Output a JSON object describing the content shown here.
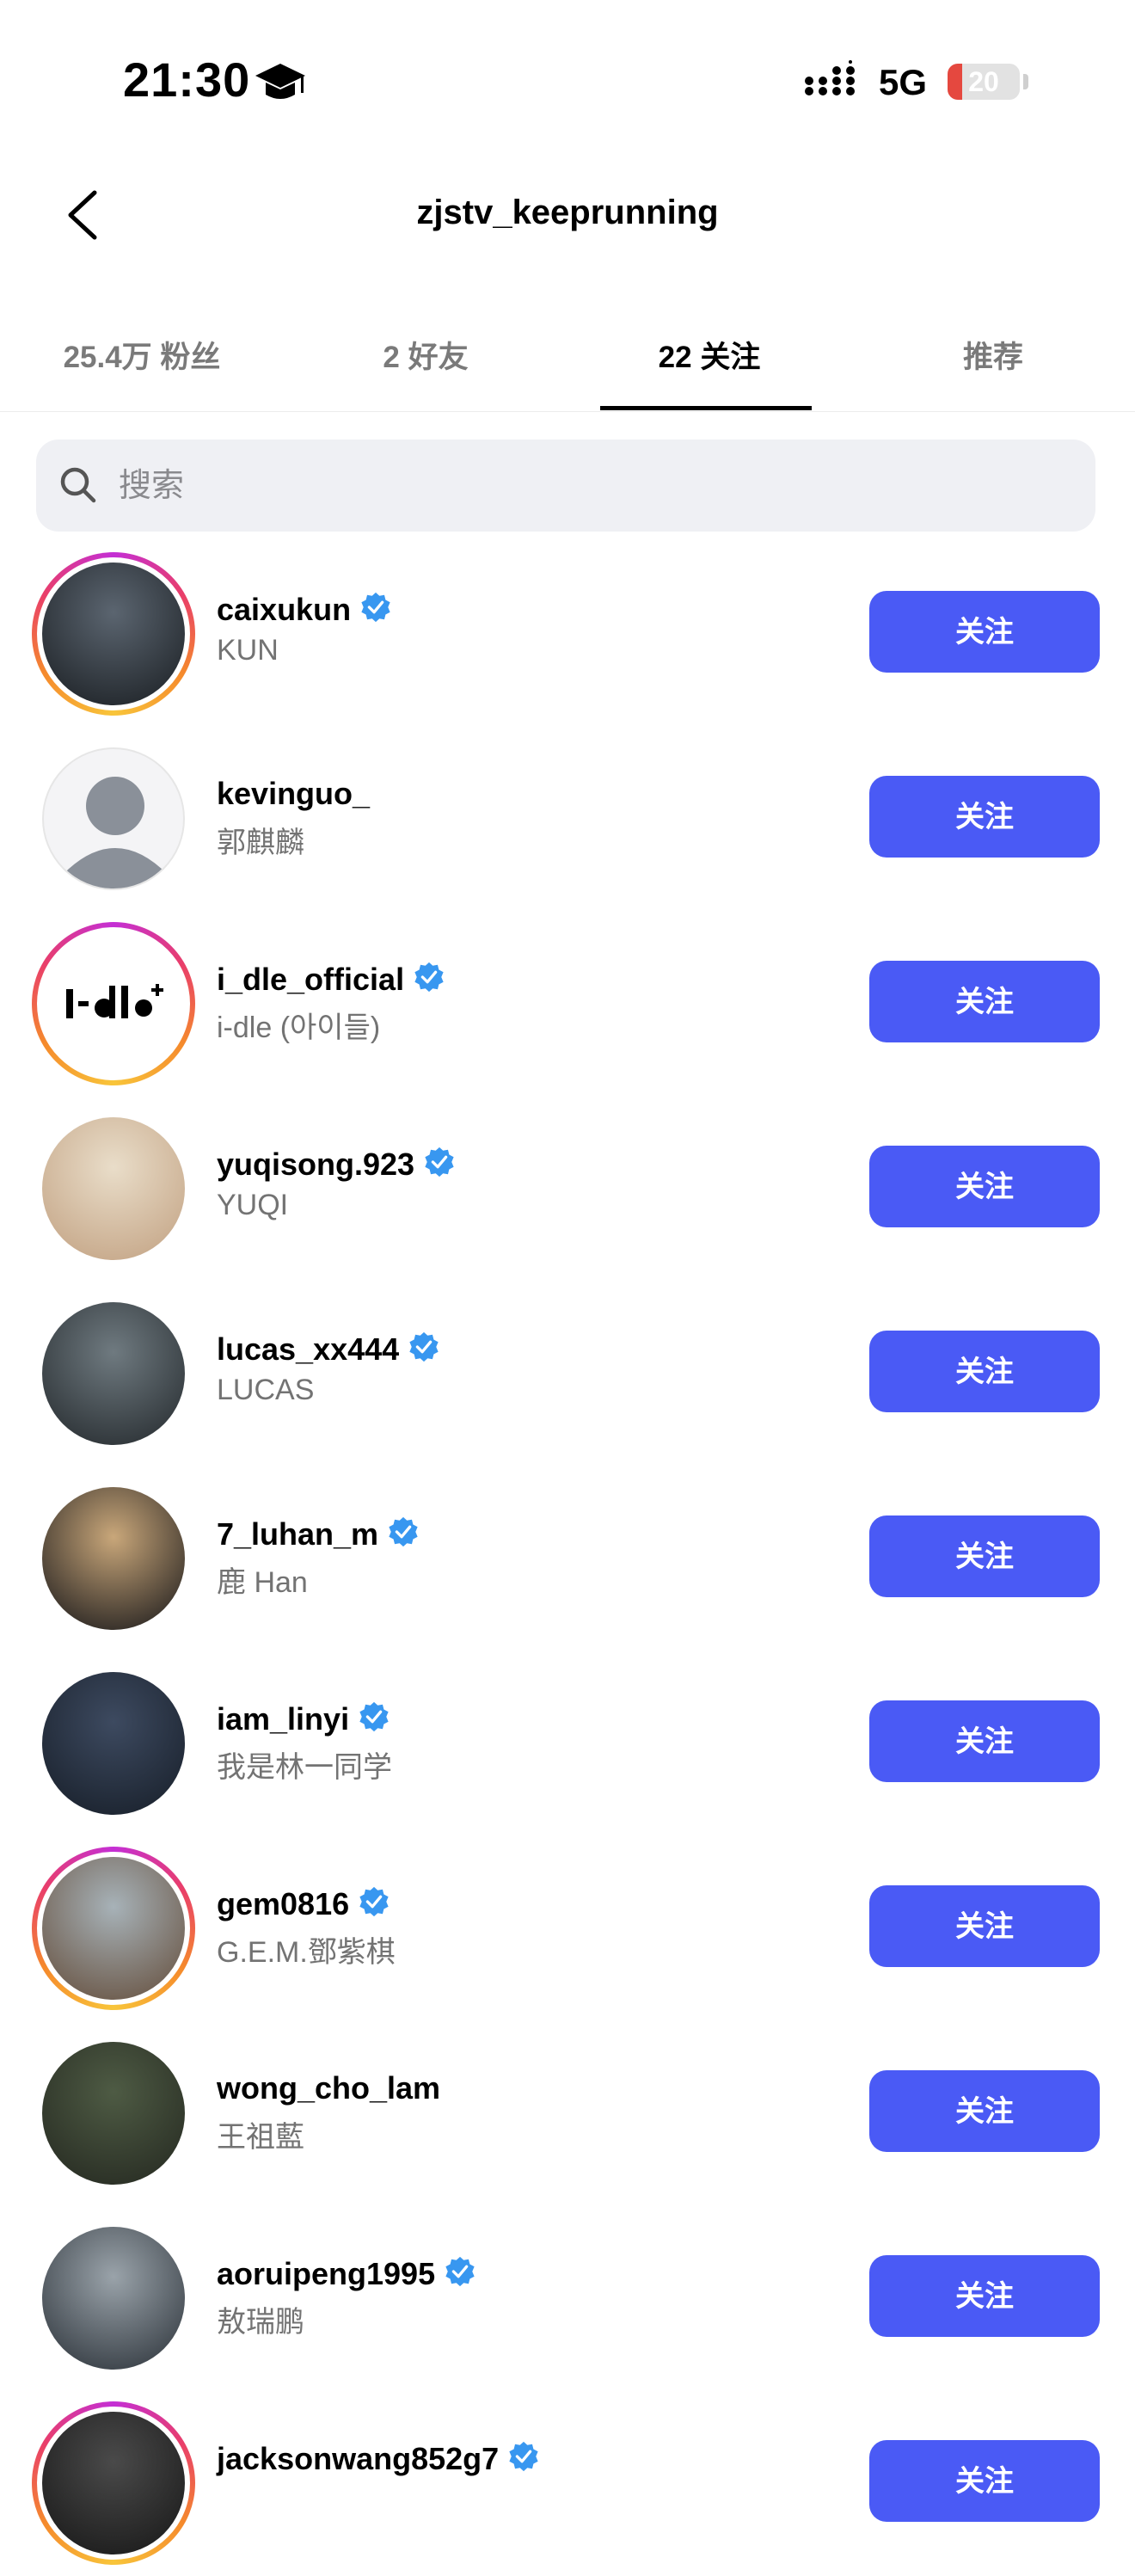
{
  "status_bar": {
    "time": "21:30",
    "network": "5G",
    "battery": "20",
    "battery_level": 0.2
  },
  "header": {
    "title": "zjstv_keeprunning"
  },
  "tabs": [
    {
      "label": "25.4万 粉丝"
    },
    {
      "label": "2 好友"
    },
    {
      "label": "22 关注",
      "active": true
    },
    {
      "label": "推荐"
    }
  ],
  "search": {
    "placeholder": "搜索"
  },
  "users": [
    {
      "username": "caixukun",
      "name": "KUN",
      "verified": true,
      "story": true,
      "follow_label": "关注"
    },
    {
      "username": "kevinguo_",
      "name": "郭麒麟",
      "verified": false,
      "story": false,
      "follow_label": "关注"
    },
    {
      "username": "i_dle_official",
      "name": "i-dle (아이들)",
      "verified": true,
      "story": true,
      "follow_label": "关注"
    },
    {
      "username": "yuqisong.923",
      "name": "YUQI",
      "verified": true,
      "story": false,
      "follow_label": "关注"
    },
    {
      "username": "lucas_xx444",
      "name": "LUCAS",
      "verified": true,
      "story": false,
      "follow_label": "关注"
    },
    {
      "username": "7_luhan_m",
      "name": "鹿 Han",
      "verified": true,
      "story": false,
      "follow_label": "关注"
    },
    {
      "username": "iam_linyi",
      "name": "我是林一同学",
      "verified": true,
      "story": false,
      "follow_label": "关注"
    },
    {
      "username": "gem0816",
      "name": "G.E.M.鄧紫棋",
      "verified": true,
      "story": true,
      "follow_label": "关注"
    },
    {
      "username": "wong_cho_lam",
      "name": "王祖藍",
      "verified": false,
      "story": false,
      "follow_label": "关注"
    },
    {
      "username": "aoruipeng1995",
      "name": "敖瑞鹏",
      "verified": true,
      "story": false,
      "follow_label": "关注"
    },
    {
      "username": "jacksonwang852g7",
      "name": "",
      "verified": true,
      "story": true,
      "follow_label": "关注"
    }
  ],
  "colors": {
    "accent": "#4a5af5",
    "verified": "#3897f0"
  }
}
